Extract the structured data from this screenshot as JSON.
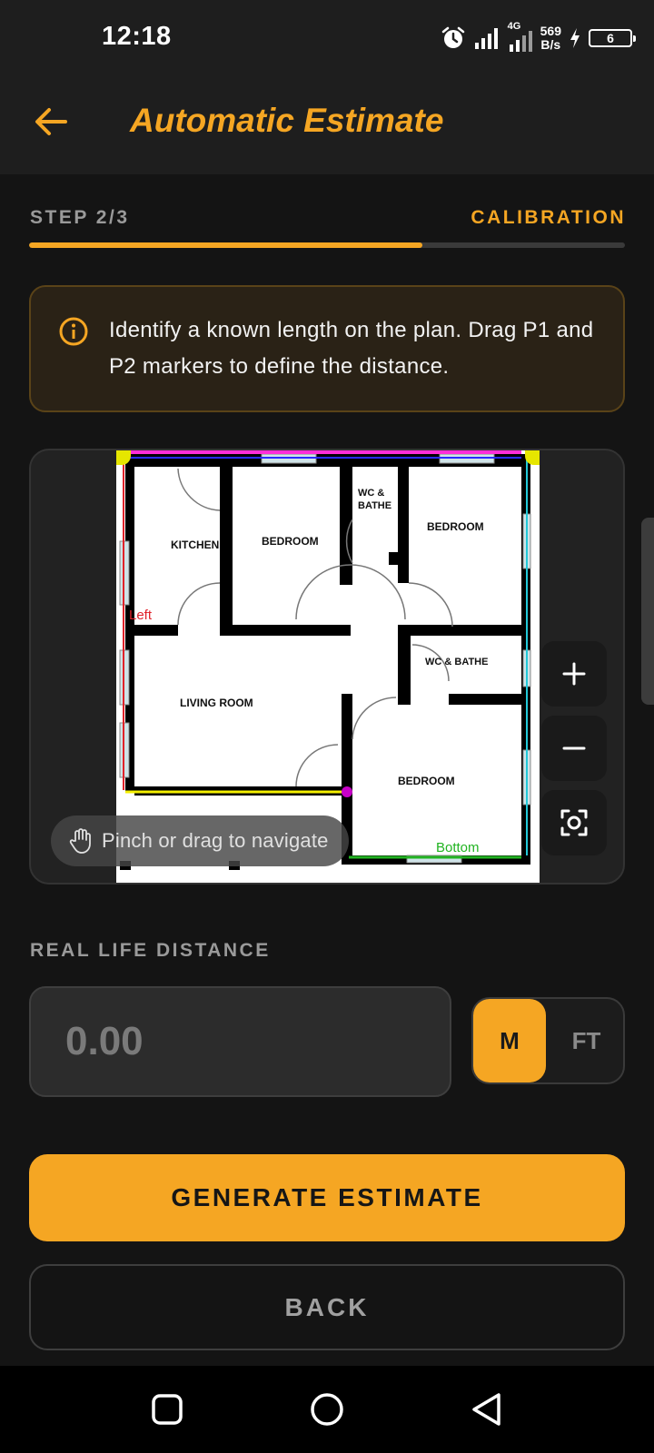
{
  "status": {
    "time": "12:18",
    "net_speed_value": "569",
    "net_speed_unit": "B/s",
    "network": "4G",
    "battery": "6"
  },
  "appbar": {
    "title": "Automatic Estimate",
    "back_icon": "arrow-left-icon"
  },
  "step": {
    "label": "STEP 2/3",
    "name": "CALIBRATION",
    "progress": 0.66
  },
  "info": {
    "icon": "info-icon",
    "text": "Identify a known length on the plan. Drag P1 and P2 markers to define the distance."
  },
  "plan": {
    "rooms": [
      "KITCHEN",
      "BEDROOM",
      "WC &",
      "BATHE",
      "BEDROOM",
      "WC & BATHE",
      "LIVING ROOM",
      "BEDROOM"
    ],
    "edge_labels": [
      "Left",
      "Bottom"
    ],
    "hint": "Pinch or drag to navigate",
    "controls": [
      "zoom-in-icon",
      "zoom-out-icon",
      "recenter-icon"
    ]
  },
  "distance": {
    "label": "REAL LIFE DISTANCE",
    "placeholder": "0.00",
    "value": "",
    "units": [
      "M",
      "FT"
    ],
    "selected_unit": "M"
  },
  "actions": {
    "generate": "GENERATE ESTIMATE",
    "back": "BACK"
  },
  "colors": {
    "accent": "#f5a623",
    "background": "#141414",
    "surface": "#1e1e1e"
  }
}
